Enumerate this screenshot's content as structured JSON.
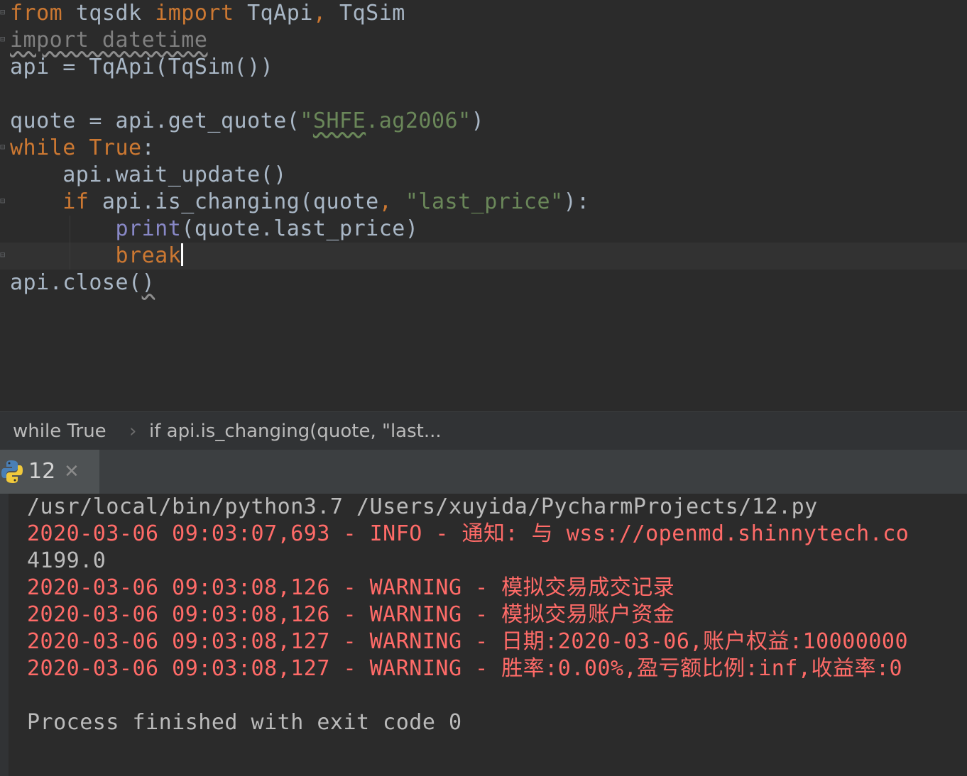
{
  "editor": {
    "lines": {
      "l1": {
        "kw_from": "from",
        "mod": " tqsdk ",
        "kw_import": "import",
        "names": " TqApi",
        "comma": ",",
        "names2": " TqSim"
      },
      "l2": {
        "text": "import datetime"
      },
      "l3": {
        "text": "api = TqApi(TqSim())"
      },
      "l5": {
        "pre": "quote = api.get_quote(",
        "q1": "\"",
        "str_a": "SHFE",
        "str_b": ".ag2006",
        "q2": "\"",
        "post": ")"
      },
      "l6": {
        "kw_while": "while",
        "kw_true": " True",
        "colon": ":"
      },
      "l7": {
        "text": "    api.wait_update()"
      },
      "l8": {
        "indent": "    ",
        "kw_if": "if",
        "mid": " api.is_changing(quote",
        "comma": ",",
        "sp": " ",
        "str": "\"last_price\"",
        "end": "):"
      },
      "l9": {
        "indent": "        ",
        "builtin": "print",
        "rest": "(quote.last_price)"
      },
      "l10": {
        "indent": "        ",
        "kw_break": "break"
      },
      "l11": {
        "pre": "api.close(",
        "paren": ")"
      }
    }
  },
  "breadcrumb": {
    "item1": "while True",
    "separator": "›",
    "item2": "if api.is_changing(quote, \"last..."
  },
  "run_panel": {
    "tab_label": "12",
    "tab_icon": "python-icon",
    "close_glyph": "✕"
  },
  "console": {
    "lines": [
      "/usr/local/bin/python3.7 /Users/xuyida/PycharmProjects/12.py",
      "2020-03-06 09:03:07,693 - INFO - 通知: 与 wss://openmd.shinnytech.co",
      "4199.0",
      "2020-03-06 09:03:08,126 - WARNING - 模拟交易成交记录",
      "2020-03-06 09:03:08,126 - WARNING - 模拟交易账户资金",
      "2020-03-06 09:03:08,127 - WARNING - 日期:2020-03-06,账户权益:10000000",
      "2020-03-06 09:03:08,127 - WARNING - 胜率:0.00%,盈亏额比例:inf,收益率:0",
      "Process finished with exit code 0"
    ]
  },
  "colors": {
    "keyword": "#cc7832",
    "string": "#6a8759",
    "builtin": "#8888c6",
    "default_text": "#a9b7c6",
    "console_error": "#ff6b68",
    "background": "#2b2b2b"
  }
}
